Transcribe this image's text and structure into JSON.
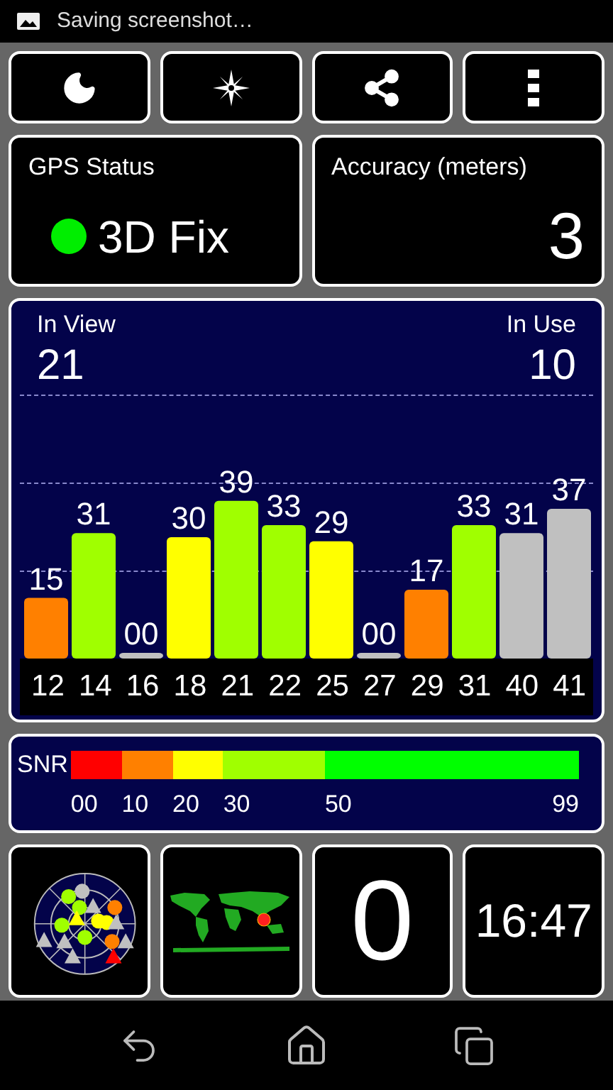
{
  "status_bar": {
    "notification": "Saving screenshot…"
  },
  "gps_status": {
    "title": "GPS Status",
    "status": "3D Fix",
    "color": "#00ee00"
  },
  "accuracy": {
    "title": "Accuracy (meters)",
    "value": "3"
  },
  "satellites": {
    "in_view_label": "In View",
    "in_view": "21",
    "in_use_label": "In Use",
    "in_use": "10",
    "chart_data": {
      "type": "bar",
      "categories": [
        "12",
        "14",
        "16",
        "18",
        "21",
        "22",
        "25",
        "27",
        "29",
        "31",
        "40",
        "41"
      ],
      "values": [
        15,
        31,
        0,
        30,
        39,
        33,
        29,
        0,
        17,
        33,
        31,
        37
      ],
      "value_labels": [
        "15",
        "31",
        "00",
        "30",
        "39",
        "33",
        "29",
        "00",
        "17",
        "33",
        "31",
        "37"
      ]
    },
    "bars": [
      {
        "color": "#ff8000"
      },
      {
        "color": "#a0ff00"
      },
      {
        "color": "#c0c0c0"
      },
      {
        "color": "#ffff00"
      },
      {
        "color": "#a0ff00"
      },
      {
        "color": "#a0ff00"
      },
      {
        "color": "#ffff00"
      },
      {
        "color": "#c0c0c0"
      },
      {
        "color": "#ff8000"
      },
      {
        "color": "#a0ff00"
      },
      {
        "color": "#c0c0c0"
      },
      {
        "color": "#c0c0c0"
      }
    ]
  },
  "snr_legend": {
    "label": "SNR",
    "segments": [
      {
        "color": "#ff0000",
        "label": "00"
      },
      {
        "color": "#ff8000",
        "label": "10"
      },
      {
        "color": "#ffff00",
        "label": "20"
      },
      {
        "color": "#a0ff00",
        "label": "30"
      },
      {
        "color": "#00ff00",
        "label": "50",
        "end_label": "99"
      }
    ]
  },
  "tiles": {
    "tile_3": "0",
    "clock": "16:47"
  }
}
